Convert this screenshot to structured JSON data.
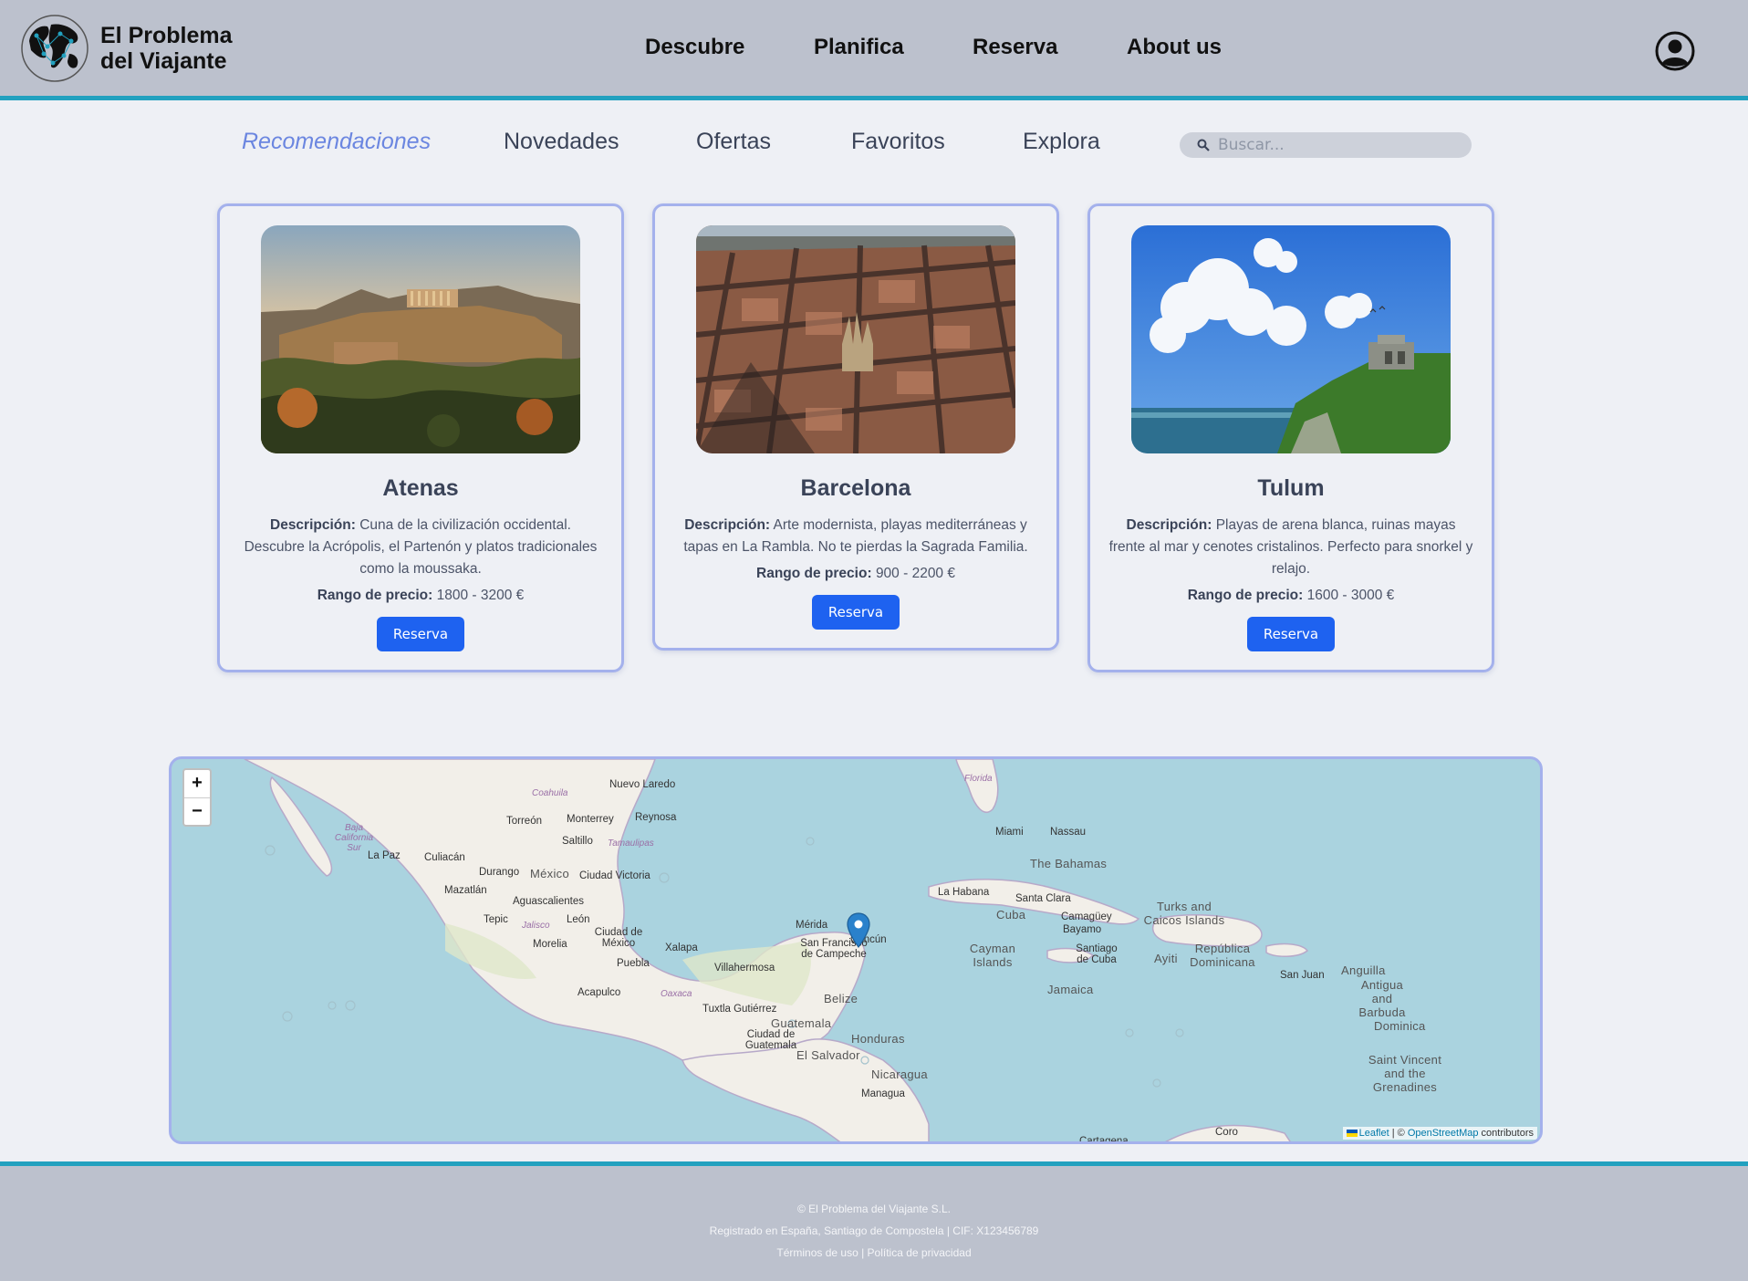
{
  "brand": {
    "line1": "El Problema",
    "line2": "del Viajante"
  },
  "nav": [
    "Descubre",
    "Planifica",
    "Reserva",
    "About us"
  ],
  "icons": {
    "logo": "world-map-logo",
    "user": "user-circle-icon",
    "search": "search-icon",
    "marker": "map-marker-icon"
  },
  "colors": {
    "header_bg": "#bcc1cd",
    "accent_line": "#22a1bf",
    "active_tab": "#6b86e0",
    "card_border": "#a4b1ec",
    "button": "#1e62f0"
  },
  "tabs": {
    "items": [
      "Recomendaciones",
      "Novedades",
      "Ofertas",
      "Favoritos",
      "Explora"
    ],
    "active": "Recomendaciones"
  },
  "search": {
    "placeholder": "Buscar..."
  },
  "cards": [
    {
      "title": "Atenas",
      "desc_label": "Descripción:",
      "desc": "Cuna de la civilización occidental. Descubre la Acrópolis, el Partenón y platos tradicionales como la moussaka.",
      "price_label": "Rango de precio:",
      "price": "1800 - 3200 €",
      "button": "Reserva"
    },
    {
      "title": "Barcelona",
      "desc_label": "Descripción:",
      "desc": "Arte modernista, playas mediterráneas y tapas en La Rambla. No te pierdas la Sagrada Familia.",
      "price_label": "Rango de precio:",
      "price": "900 - 2200 €",
      "button": "Reserva"
    },
    {
      "title": "Tulum",
      "desc_label": "Descripción:",
      "desc": "Playas de arena blanca, ruinas mayas frente al mar y cenotes cristalinos. Perfecto para snorkel y relajo.",
      "price_label": "Rango de precio:",
      "price": "1600 - 3000 €",
      "button": "Reserva"
    }
  ],
  "map": {
    "zoom_in": "+",
    "zoom_out": "−",
    "attribution": {
      "leaflet": "Leaflet",
      "sep": " | © ",
      "osm": "OpenStreetMap",
      "suffix": " contributors"
    },
    "places": [
      "Nuevo Laredo",
      "Coahuila",
      "Monterrey",
      "Reynosa",
      "Torreón",
      "Saltillo",
      "Tamaulipas",
      "Baja California Sur",
      "La Paz",
      "Culiacán",
      "Durango",
      "México",
      "Ciudad Victoria",
      "Mazatlán",
      "Aguascalientes",
      "Tepic",
      "Jalisco",
      "León",
      "Ciudad de México",
      "Morelia",
      "Puebla",
      "Xalapa",
      "Acapulco",
      "Oaxaca",
      "Villahermosa",
      "Tuxtla Gutiérrez",
      "Mérida",
      "Cancún",
      "San Francisco de Campeche",
      "Belize",
      "Guatemala",
      "Ciudad de Guatemala",
      "El Salvador",
      "Honduras",
      "Nicaragua",
      "Managua",
      "Florida",
      "Miami",
      "Nassau",
      "The Bahamas",
      "La Habana",
      "Santa Clara",
      "Cuba",
      "Camagüey",
      "Bayamo",
      "Santiago de Cuba",
      "Cayman Islands",
      "Jamaica",
      "Turks and Caicos Islands",
      "Ayiti",
      "República Dominicana",
      "San Juan",
      "Anguilla",
      "Antigua and Barbuda",
      "Dominica",
      "Saint Vincent and the Grenadines",
      "Coro",
      "Cartagena"
    ]
  },
  "footer": {
    "copyright": "© El Problema del Viajante S.L.",
    "registered": "Registrado en España, Santiago de Compostela | CIF: X123456789",
    "terms": "Términos de uso",
    "sep": " | ",
    "privacy": "Política de privacidad"
  }
}
